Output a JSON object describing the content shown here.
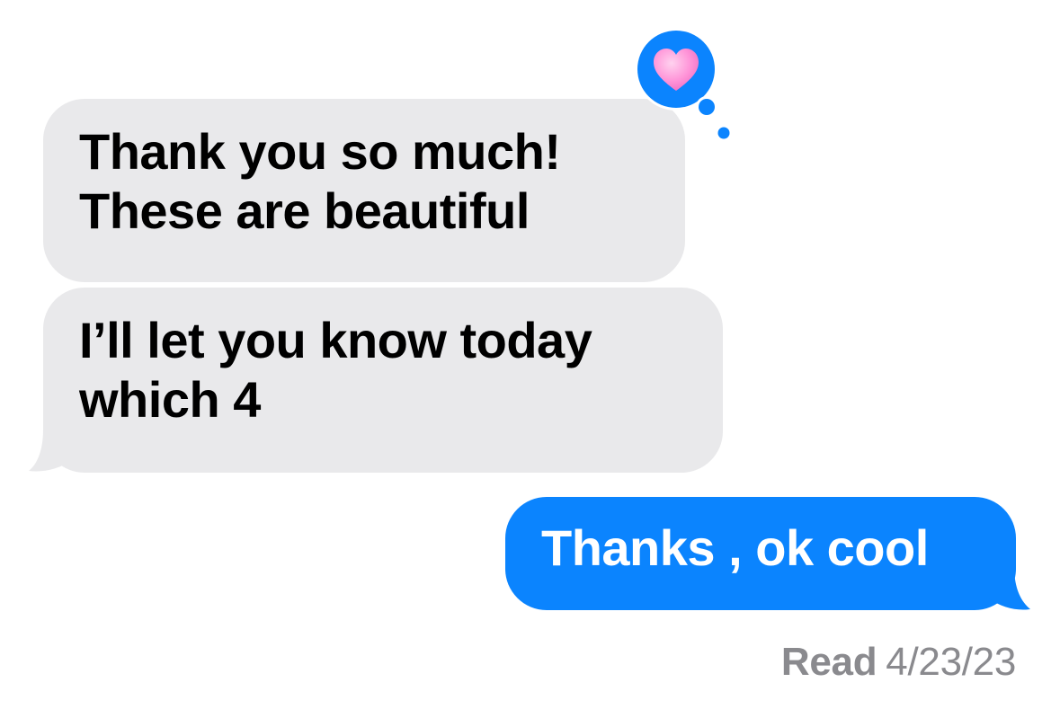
{
  "conversation": {
    "messages": [
      {
        "direction": "incoming",
        "lines": [
          "Thank you so much!",
          "These are beautiful"
        ],
        "reaction": "heart-icon"
      },
      {
        "direction": "incoming",
        "lines": [
          "I’ll let you know today",
          "which 4"
        ]
      },
      {
        "direction": "outgoing",
        "lines": [
          "Thanks , ok cool"
        ]
      }
    ],
    "read_receipt": {
      "label": "Read",
      "date": "4/23/23"
    }
  },
  "colors": {
    "incoming_bubble": "#e9e9eb",
    "outgoing_bubble": "#0b84fe",
    "tapback_bubble": "#0b84fe",
    "heart": "#ff8fd3",
    "receipt_text": "#8a8a8e"
  }
}
